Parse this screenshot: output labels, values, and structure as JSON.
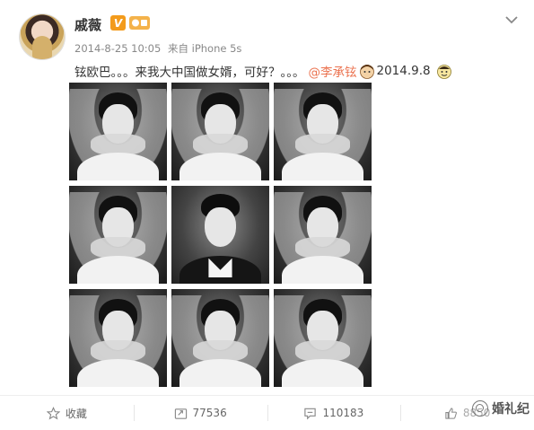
{
  "post": {
    "user_name": "戚薇",
    "verified_badge": "V",
    "meta": {
      "timestamp": "2014-8-25 10:05",
      "source_prefix": "来自",
      "source": "iPhone 5s"
    },
    "text": "铉欧巴。。。来我大中国做女婿，可好？。。。",
    "mention": "@李承铉",
    "date_tag": "2014.9.8",
    "photos": [
      {
        "label": "photo-1"
      },
      {
        "label": "photo-2"
      },
      {
        "label": "photo-3"
      },
      {
        "label": "photo-4"
      },
      {
        "label": "photo-5"
      },
      {
        "label": "photo-6"
      },
      {
        "label": "photo-7"
      },
      {
        "label": "photo-8"
      },
      {
        "label": "photo-9"
      }
    ]
  },
  "actions": {
    "favorite_label": "收藏",
    "repost_count": "77536",
    "comment_count": "110183",
    "like_count": "8850"
  },
  "watermark": {
    "text": "婚礼纪"
  },
  "colors": {
    "mention": "#eb7350",
    "vip_badge": "#f39b1b",
    "meta_text": "#888888"
  },
  "icons": [
    "chevron-down-icon",
    "star-icon",
    "repost-icon",
    "comment-icon",
    "like-icon",
    "wechat-icon"
  ]
}
